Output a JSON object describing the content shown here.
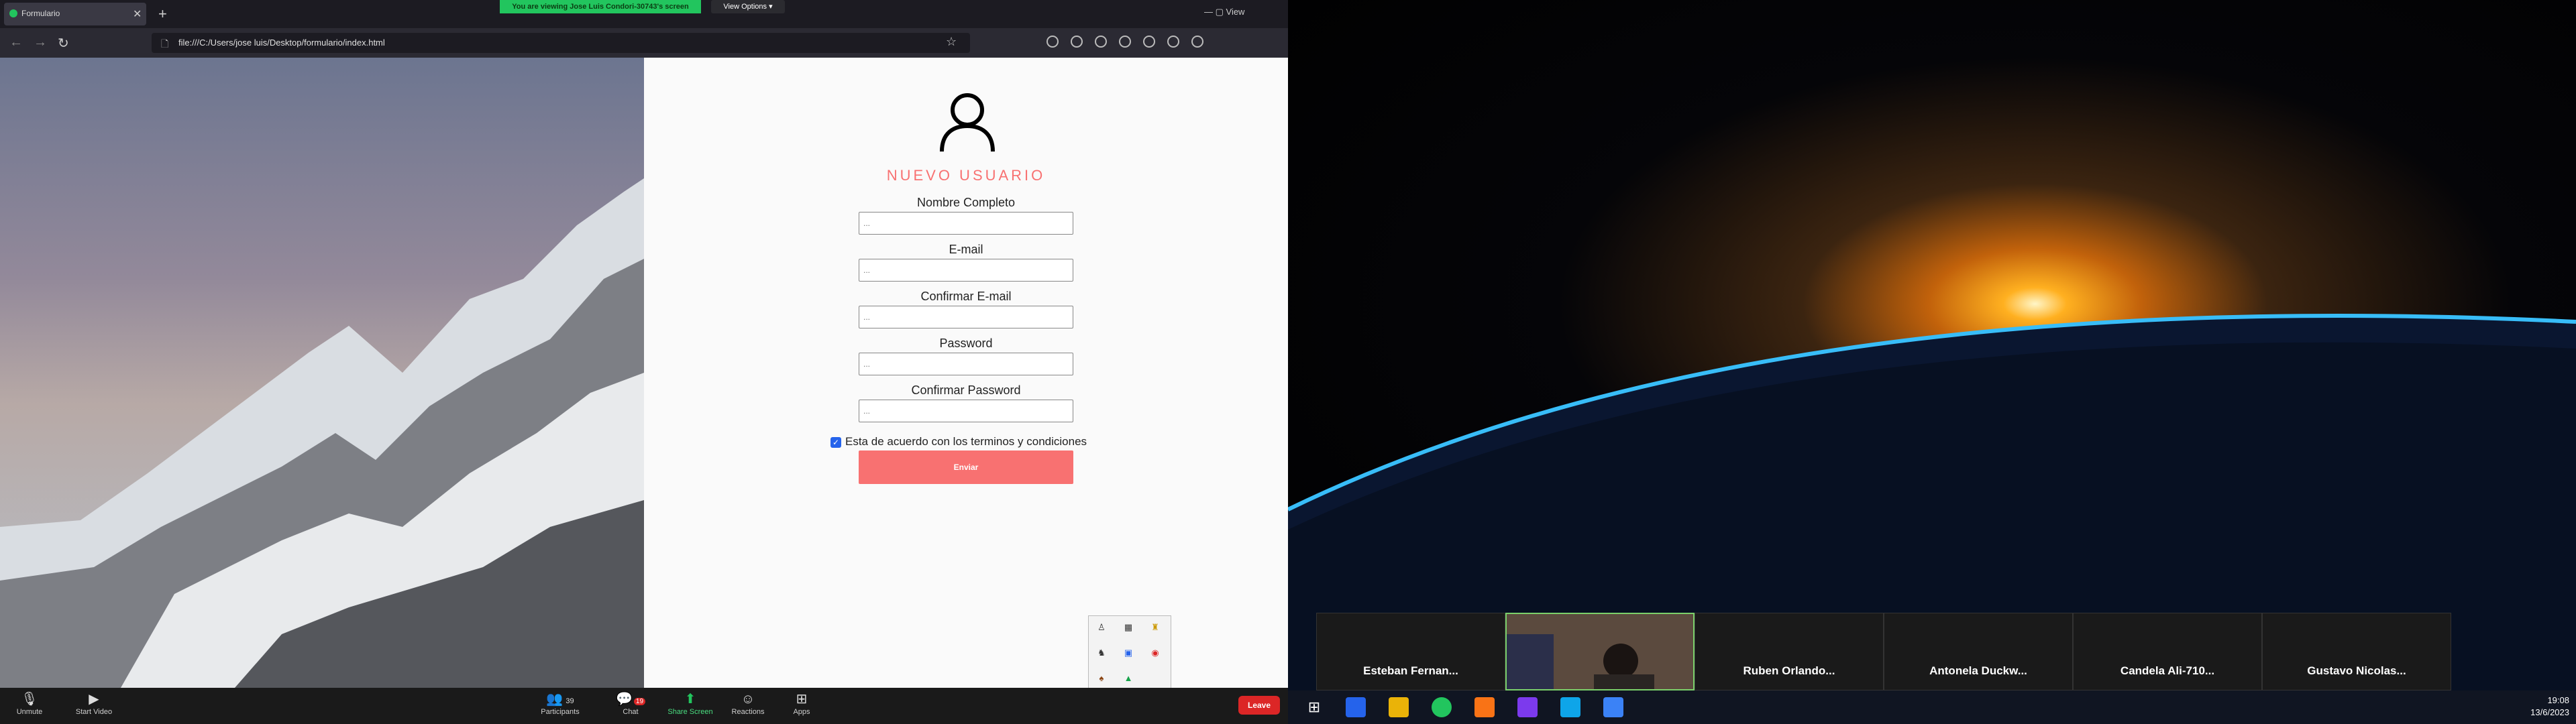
{
  "browser": {
    "tab_title": "Formulario",
    "url": "file:///C:/Users/jose luis/Desktop/formulario/index.html",
    "window_controls": "— ▢ View"
  },
  "share_banner": {
    "text": "You are viewing Jose Luis Condori-30743's screen",
    "view_options": "View Options ▾"
  },
  "form": {
    "title": "NUEVO USUARIO",
    "fields": [
      {
        "label": "Nombre Completo",
        "placeholder": "..."
      },
      {
        "label": "E-mail",
        "placeholder": "..."
      },
      {
        "label": "Confirmar E-mail",
        "placeholder": "..."
      },
      {
        "label": "Password",
        "placeholder": "..."
      },
      {
        "label": "Confirmar Password",
        "placeholder": "..."
      }
    ],
    "checkbox_label": "Esta de acuerdo con los terminos y condiciones",
    "submit_label": "Enviar"
  },
  "zoom_toolbar": {
    "unmute": "Unmute",
    "start_video": "Start Video",
    "participants": "Participants",
    "participants_count": "39",
    "chat": "Chat",
    "chat_badge": "19",
    "share_screen": "Share Screen",
    "reactions": "Reactions",
    "apps": "Apps",
    "leave": "Leave"
  },
  "participants": [
    {
      "name": "Esteban Fernan..."
    },
    {
      "name": ""
    },
    {
      "name": "Ruben Orlando..."
    },
    {
      "name": "Antonela Duckw..."
    },
    {
      "name": "Candela Ali-710..."
    },
    {
      "name": "Gustavo Nicolas..."
    }
  ],
  "clock": {
    "time": "19:08",
    "date": "13/6/2023"
  },
  "colors": {
    "accent": "#f87171",
    "share_green": "#22c55e",
    "leave_red": "#dc2626"
  }
}
